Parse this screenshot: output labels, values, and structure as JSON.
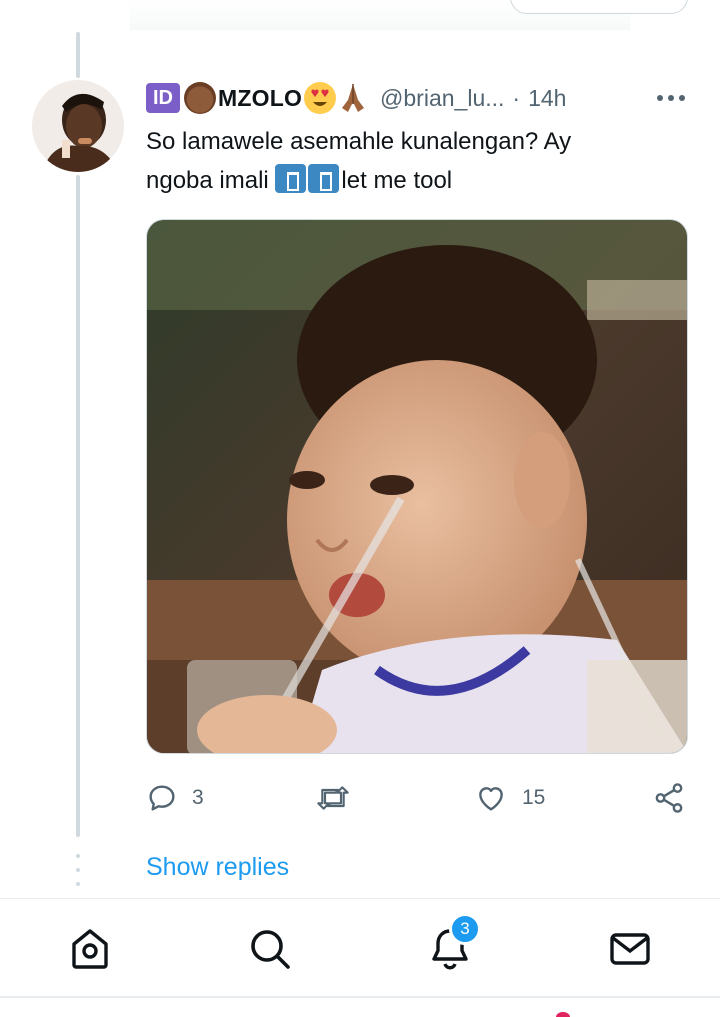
{
  "tweet": {
    "id_badge": "ID",
    "display_name": "MZOLO",
    "handle": "@brian_lu...",
    "separator": "·",
    "time": "14h",
    "text_line1": "So lamawele asemahle kunalengan? Ay",
    "text_line2_a": "ngoba imali",
    "text_line2_b": "let me tool",
    "emoji_names": [
      "id-button-emoji",
      "baby-emoji",
      "heart-eyes-emoji",
      "folded-hands-emoji",
      "put-litter-in-bin-emoji"
    ]
  },
  "actions": {
    "reply_count": "3",
    "retweet_count": "",
    "like_count": "15"
  },
  "show_replies_label": "Show replies",
  "notifications_badge": "3",
  "colors": {
    "accent": "#1d9bf0",
    "text_primary": "#0f1419",
    "text_secondary": "#536471",
    "divider": "#cfd9de",
    "id_badge": "#7b5ec7"
  },
  "icons": [
    "reply-icon",
    "retweet-icon",
    "like-icon",
    "share-icon",
    "home-icon",
    "search-icon",
    "notifications-bell-icon",
    "messages-envelope-icon",
    "more-options-icon"
  ]
}
